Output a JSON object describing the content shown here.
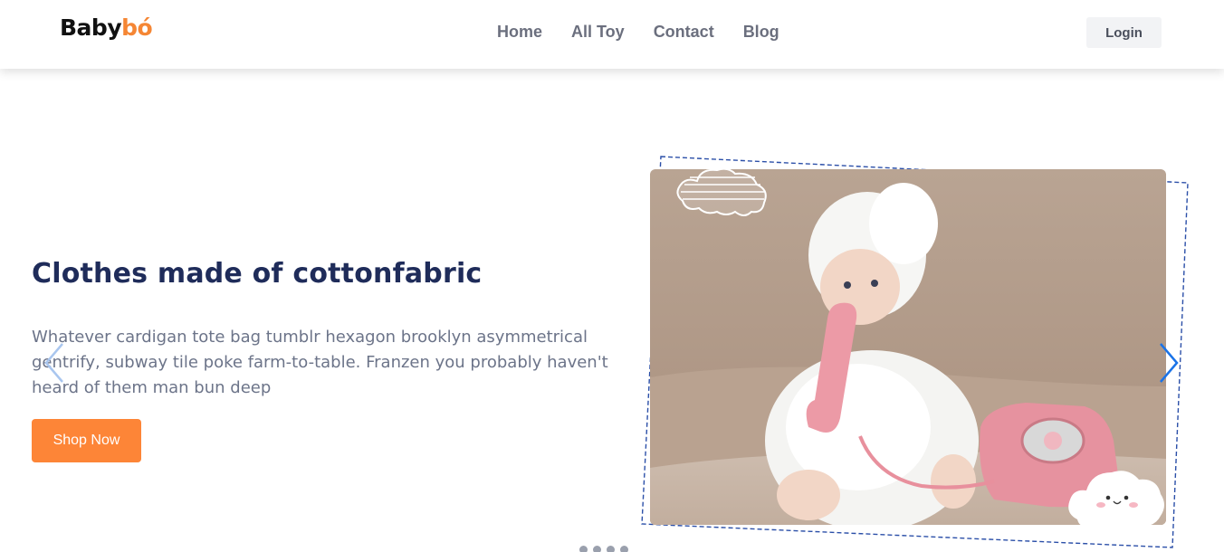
{
  "brand": {
    "logo_part1": "Baby",
    "logo_part2": "bó"
  },
  "nav": {
    "items": [
      "Home",
      "All Toy",
      "Contact",
      "Blog"
    ],
    "login_label": "Login"
  },
  "hero": {
    "title": "Clothes made of cottonfabric",
    "description": "Whatever cardigan tote bag tumblr hexagon brooklyn asymmetrical gentrify, subway tile poke farm-to-table. Franzen you probably haven't heard of them man bun deep",
    "cta_label": "Shop Now"
  },
  "slider": {
    "prev_icon": "chevron-left-icon",
    "next_icon": "chevron-right-icon",
    "image": "baby-in-bathrobe-with-pink-telephone",
    "active_color": "#1a73e8"
  },
  "colors": {
    "accent": "#fd8537",
    "title": "#1f2c5a",
    "frame": "#2b4fa8"
  }
}
